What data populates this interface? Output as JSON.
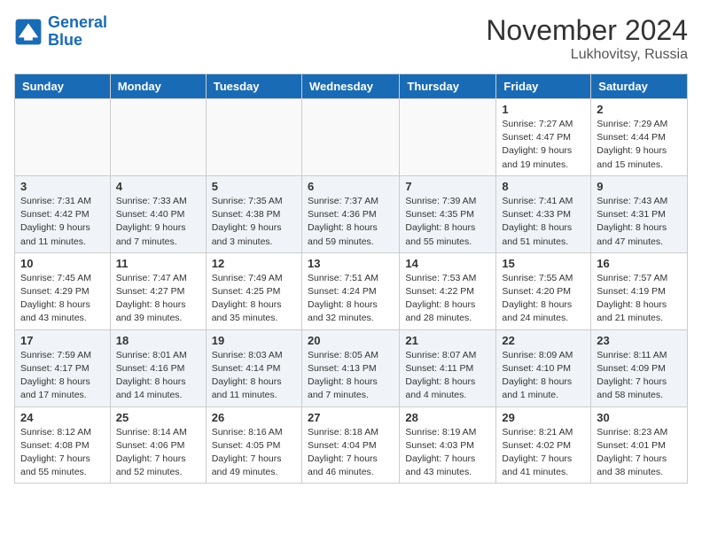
{
  "logo": {
    "line1": "General",
    "line2": "Blue"
  },
  "title": "November 2024",
  "location": "Lukhovitsy, Russia",
  "weekdays": [
    "Sunday",
    "Monday",
    "Tuesday",
    "Wednesday",
    "Thursday",
    "Friday",
    "Saturday"
  ],
  "weeks": [
    [
      {
        "day": "",
        "info": ""
      },
      {
        "day": "",
        "info": ""
      },
      {
        "day": "",
        "info": ""
      },
      {
        "day": "",
        "info": ""
      },
      {
        "day": "",
        "info": ""
      },
      {
        "day": "1",
        "info": "Sunrise: 7:27 AM\nSunset: 4:47 PM\nDaylight: 9 hours\nand 19 minutes."
      },
      {
        "day": "2",
        "info": "Sunrise: 7:29 AM\nSunset: 4:44 PM\nDaylight: 9 hours\nand 15 minutes."
      }
    ],
    [
      {
        "day": "3",
        "info": "Sunrise: 7:31 AM\nSunset: 4:42 PM\nDaylight: 9 hours\nand 11 minutes."
      },
      {
        "day": "4",
        "info": "Sunrise: 7:33 AM\nSunset: 4:40 PM\nDaylight: 9 hours\nand 7 minutes."
      },
      {
        "day": "5",
        "info": "Sunrise: 7:35 AM\nSunset: 4:38 PM\nDaylight: 9 hours\nand 3 minutes."
      },
      {
        "day": "6",
        "info": "Sunrise: 7:37 AM\nSunset: 4:36 PM\nDaylight: 8 hours\nand 59 minutes."
      },
      {
        "day": "7",
        "info": "Sunrise: 7:39 AM\nSunset: 4:35 PM\nDaylight: 8 hours\nand 55 minutes."
      },
      {
        "day": "8",
        "info": "Sunrise: 7:41 AM\nSunset: 4:33 PM\nDaylight: 8 hours\nand 51 minutes."
      },
      {
        "day": "9",
        "info": "Sunrise: 7:43 AM\nSunset: 4:31 PM\nDaylight: 8 hours\nand 47 minutes."
      }
    ],
    [
      {
        "day": "10",
        "info": "Sunrise: 7:45 AM\nSunset: 4:29 PM\nDaylight: 8 hours\nand 43 minutes."
      },
      {
        "day": "11",
        "info": "Sunrise: 7:47 AM\nSunset: 4:27 PM\nDaylight: 8 hours\nand 39 minutes."
      },
      {
        "day": "12",
        "info": "Sunrise: 7:49 AM\nSunset: 4:25 PM\nDaylight: 8 hours\nand 35 minutes."
      },
      {
        "day": "13",
        "info": "Sunrise: 7:51 AM\nSunset: 4:24 PM\nDaylight: 8 hours\nand 32 minutes."
      },
      {
        "day": "14",
        "info": "Sunrise: 7:53 AM\nSunset: 4:22 PM\nDaylight: 8 hours\nand 28 minutes."
      },
      {
        "day": "15",
        "info": "Sunrise: 7:55 AM\nSunset: 4:20 PM\nDaylight: 8 hours\nand 24 minutes."
      },
      {
        "day": "16",
        "info": "Sunrise: 7:57 AM\nSunset: 4:19 PM\nDaylight: 8 hours\nand 21 minutes."
      }
    ],
    [
      {
        "day": "17",
        "info": "Sunrise: 7:59 AM\nSunset: 4:17 PM\nDaylight: 8 hours\nand 17 minutes."
      },
      {
        "day": "18",
        "info": "Sunrise: 8:01 AM\nSunset: 4:16 PM\nDaylight: 8 hours\nand 14 minutes."
      },
      {
        "day": "19",
        "info": "Sunrise: 8:03 AM\nSunset: 4:14 PM\nDaylight: 8 hours\nand 11 minutes."
      },
      {
        "day": "20",
        "info": "Sunrise: 8:05 AM\nSunset: 4:13 PM\nDaylight: 8 hours\nand 7 minutes."
      },
      {
        "day": "21",
        "info": "Sunrise: 8:07 AM\nSunset: 4:11 PM\nDaylight: 8 hours\nand 4 minutes."
      },
      {
        "day": "22",
        "info": "Sunrise: 8:09 AM\nSunset: 4:10 PM\nDaylight: 8 hours\nand 1 minute."
      },
      {
        "day": "23",
        "info": "Sunrise: 8:11 AM\nSunset: 4:09 PM\nDaylight: 7 hours\nand 58 minutes."
      }
    ],
    [
      {
        "day": "24",
        "info": "Sunrise: 8:12 AM\nSunset: 4:08 PM\nDaylight: 7 hours\nand 55 minutes."
      },
      {
        "day": "25",
        "info": "Sunrise: 8:14 AM\nSunset: 4:06 PM\nDaylight: 7 hours\nand 52 minutes."
      },
      {
        "day": "26",
        "info": "Sunrise: 8:16 AM\nSunset: 4:05 PM\nDaylight: 7 hours\nand 49 minutes."
      },
      {
        "day": "27",
        "info": "Sunrise: 8:18 AM\nSunset: 4:04 PM\nDaylight: 7 hours\nand 46 minutes."
      },
      {
        "day": "28",
        "info": "Sunrise: 8:19 AM\nSunset: 4:03 PM\nDaylight: 7 hours\nand 43 minutes."
      },
      {
        "day": "29",
        "info": "Sunrise: 8:21 AM\nSunset: 4:02 PM\nDaylight: 7 hours\nand 41 minutes."
      },
      {
        "day": "30",
        "info": "Sunrise: 8:23 AM\nSunset: 4:01 PM\nDaylight: 7 hours\nand 38 minutes."
      }
    ]
  ]
}
